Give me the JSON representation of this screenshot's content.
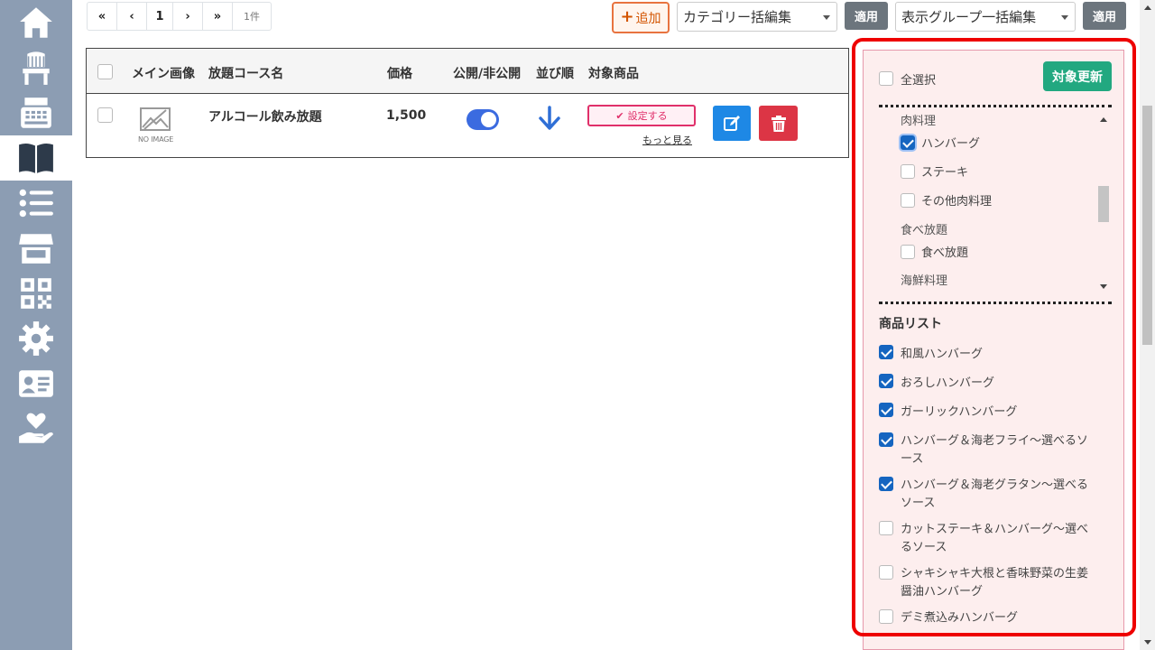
{
  "pager": {
    "first": "«",
    "prev": "‹",
    "page": "1",
    "next": "›",
    "last": "»",
    "count": "1件"
  },
  "toolbar": {
    "add_label": "追加",
    "category_select": "カテゴリー括編集",
    "apply1": "適用",
    "group_select": "表示グループ一括編集",
    "apply2": "適用"
  },
  "table": {
    "headers": [
      "メイン画像",
      "放題コース名",
      "価格",
      "公開/非公開",
      "並び順",
      "対象商品"
    ],
    "rows": [
      {
        "no_image": "NO IMAGE",
        "name": "アルコール飲み放題",
        "price": "1,500",
        "published": true,
        "set_label": "設定する",
        "more": "もっと見る"
      }
    ]
  },
  "panel": {
    "select_all": "全選択",
    "update_button": "対象更新",
    "categories": [
      {
        "group": "肉料理",
        "items": [
          {
            "label": "ハンバーグ",
            "checked": true
          },
          {
            "label": "ステーキ",
            "checked": false
          },
          {
            "label": "その他肉料理",
            "checked": false
          }
        ]
      },
      {
        "group": "食べ放題",
        "items": [
          {
            "label": "食べ放題",
            "checked": false
          }
        ]
      },
      {
        "group": "海鮮料理",
        "items": []
      }
    ],
    "product_list_title": "商品リスト",
    "products": [
      {
        "label": "和風ハンバーグ",
        "checked": true
      },
      {
        "label": "おろしハンバーグ",
        "checked": true
      },
      {
        "label": "ガーリックハンバーグ",
        "checked": true
      },
      {
        "label_line1": "ハンバーグ＆海老フライ〜選べるソ",
        "label_line2": "ース",
        "checked": true
      },
      {
        "label_line1": "ハンバーグ＆海老グラタン〜選べる",
        "label_line2": "ソース",
        "checked": true
      },
      {
        "label_line1": "カットステーキ＆ハンバーグ〜選べ",
        "label_line2": "るソース",
        "checked": false
      },
      {
        "label_line1": "シャキシャキ大根と香味野菜の生姜",
        "label_line2": "醤油ハンバーグ",
        "checked": false
      },
      {
        "label": "デミ煮込みハンバーグ",
        "checked": false
      }
    ]
  },
  "sidebar_icons": [
    "home-icon",
    "chair-icon",
    "cash-register-icon",
    "menu-book-icon",
    "list-icon",
    "store-icon",
    "qr-code-icon",
    "gear-icon",
    "id-card-icon",
    "hand-heart-icon"
  ],
  "colors": {
    "sidebar": "#8c9db3",
    "accent_blue": "#1565c0",
    "update_green": "#22a880",
    "delete_red": "#dc3545",
    "highlight_red": "#e00"
  }
}
